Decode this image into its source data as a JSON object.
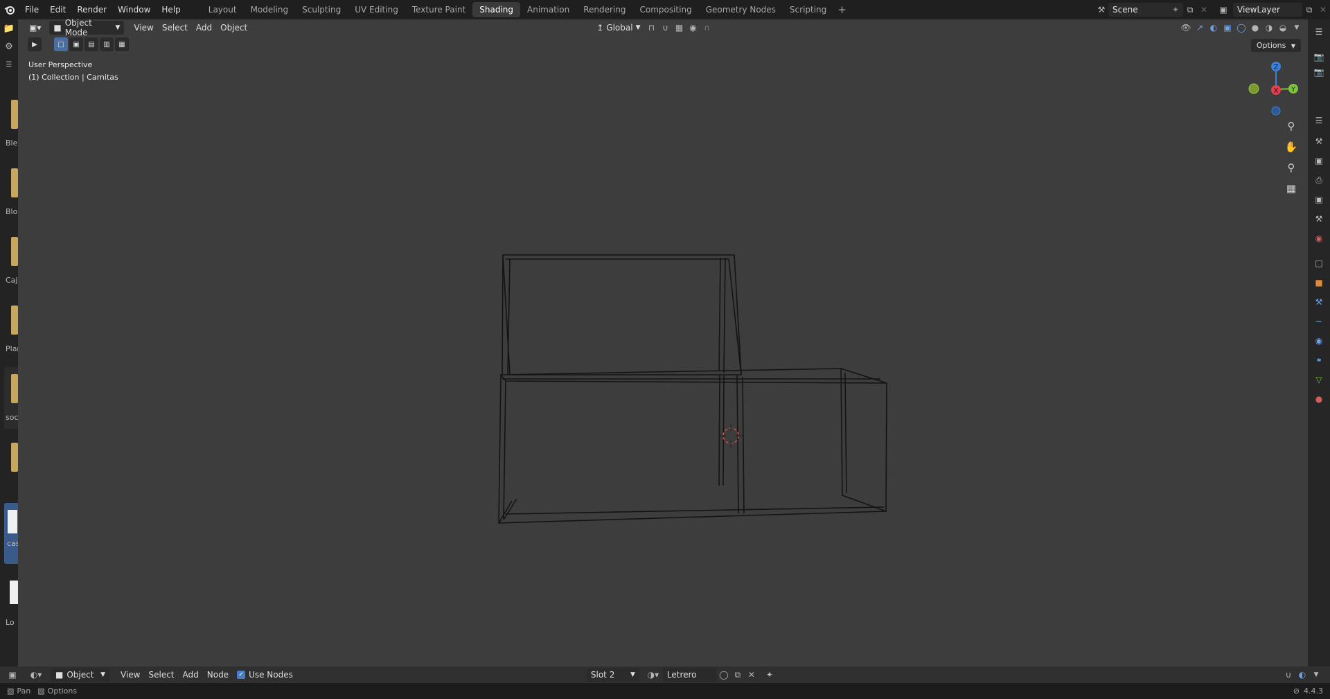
{
  "app": {
    "logo_icon": "blender-logo-icon",
    "menus": [
      "File",
      "Edit",
      "Render",
      "Window",
      "Help"
    ],
    "workspaces": [
      "Layout",
      "Modeling",
      "Sculpting",
      "UV Editing",
      "Texture Paint",
      "Shading",
      "Animation",
      "Rendering",
      "Compositing",
      "Geometry Nodes",
      "Scripting"
    ],
    "active_workspace": "Shading",
    "add_workspace": "+",
    "scene": "Scene",
    "view_layer": "ViewLayer"
  },
  "viewport_header": {
    "mode": "Object Mode",
    "menus": [
      "View",
      "Select",
      "Add",
      "Object"
    ],
    "transform_orientation": "Global",
    "options_label": "Options"
  },
  "viewport": {
    "perspective_label": "User Perspective",
    "collection_label": "(1) Collection | Carnitas",
    "gizmo_axes": [
      "Z",
      "X",
      "Y"
    ],
    "accent_colors": {
      "x": "#e0404f",
      "y": "#7ec23f",
      "z": "#3d80d8"
    }
  },
  "asset_browser": {
    "items": [
      "Blen",
      "Bloc",
      "Caja",
      "Plan",
      "soci",
      "",
      "cas",
      "Lo"
    ]
  },
  "node_header": {
    "editor": "Object",
    "menus": [
      "View",
      "Select",
      "Add",
      "Node"
    ],
    "use_nodes_label": "Use Nodes",
    "use_nodes_checked": true,
    "slot": "Slot 2",
    "material": "Letrero"
  },
  "status_bar": {
    "pan_label": "Pan",
    "options_label": "Options",
    "version": "4.4.3"
  }
}
